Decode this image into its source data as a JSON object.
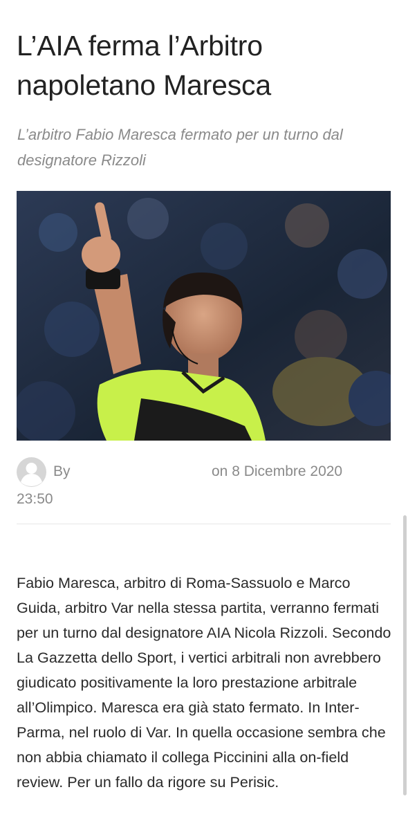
{
  "article": {
    "title": "L’AIA ferma l’Arbitro napoletano Maresca",
    "subtitle": "L’arbitro Fabio Maresca fermato per un turno dal designatore Rizzoli",
    "meta": {
      "by_label": "By",
      "date": "on 8 Dicembre 2020",
      "time": "23:50"
    },
    "body": "Fabio Maresca, arbitro di Roma-Sassuolo e Marco Guida, arbitro Var nella stessa partita, verranno fermati per un turno dal designatore AIA Nicola Rizzoli. Secondo La Gazzetta dello Sport, i vertici arbitrali non avrebbero giudicato positivamente la loro prestazione arbitrale all’Olimpico. Maresca era già stato fermato. In Inter-Parma, nel ruolo di Var. In quella occasione sembra che non abbia chiamato il collega Piccinini alla on-field review. Per un fallo da rigore su Perisic."
  },
  "colors": {
    "text": "#222222",
    "muted": "#8a8a8a",
    "jersey": "#c8f04a",
    "crowd": "#1f2a3c"
  },
  "icons": {
    "avatar": "user-avatar-icon"
  }
}
